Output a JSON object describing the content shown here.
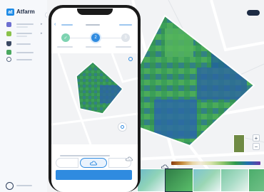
{
  "brand": {
    "logo_text": "at",
    "name": "Atfarm"
  },
  "sidebar": {
    "collapse_icon": "chevron-left-icon",
    "items": [
      {
        "icon": "field-icon",
        "color": "#6d6fd0"
      },
      {
        "icon": "map-icon",
        "color": "#8ac24a"
      },
      {
        "icon": "tractor-icon",
        "color": "#3b4a63"
      },
      {
        "icon": "stats-icon",
        "color": "#4aa85f"
      },
      {
        "icon": "settings-icon",
        "color": "#5b6b84"
      }
    ],
    "bottom_icon": "help-icon"
  },
  "phone": {
    "steps": [
      {
        "label": "✓",
        "state": "done",
        "color": "#5fc99a"
      },
      {
        "label": "2",
        "state": "active",
        "color": "#2f8be0"
      },
      {
        "label": "3",
        "state": "pending",
        "color": "#d7dde6"
      }
    ],
    "info_icon": "info-icon",
    "locate_icon": "locate-icon",
    "cloud_icon": "cloud-icon",
    "toggle_options": [
      "left",
      "cloud",
      "right"
    ],
    "toggle_selected": "cloud"
  },
  "map_controls": {
    "zoom_in": "+",
    "zoom_out": "−",
    "cloud_filter_icon": "cloud-icon"
  },
  "colors": {
    "accent": "#2f8be0",
    "success": "#5fc99a",
    "field_outline": "#ffffff"
  }
}
